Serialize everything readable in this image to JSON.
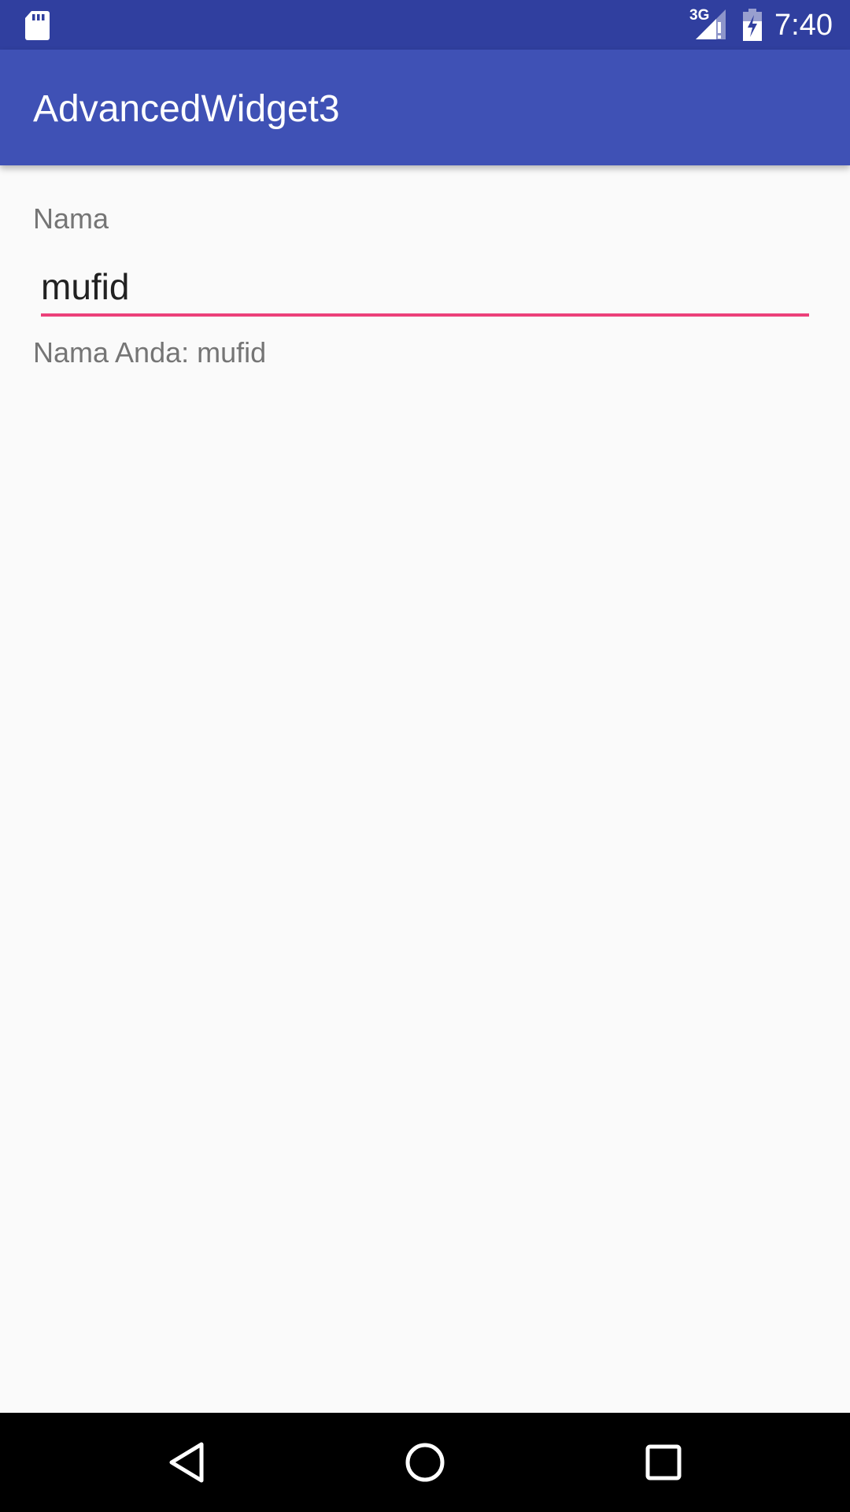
{
  "status_bar": {
    "time": "7:40",
    "network_type": "3G",
    "icons": [
      "sd-card-icon",
      "signal-icon",
      "battery-charging-icon"
    ]
  },
  "app_bar": {
    "title": "AdvancedWidget3"
  },
  "form": {
    "name_label": "Nama",
    "name_value": "mufid",
    "result_text": "Nama Anda: mufid"
  },
  "nav_bar": {
    "icons": [
      "back-icon",
      "home-icon",
      "recents-icon"
    ]
  },
  "colors": {
    "status_bar": "#303f9f",
    "app_bar": "#3f51b5",
    "accent": "#ec407a",
    "background": "#fafafa"
  }
}
